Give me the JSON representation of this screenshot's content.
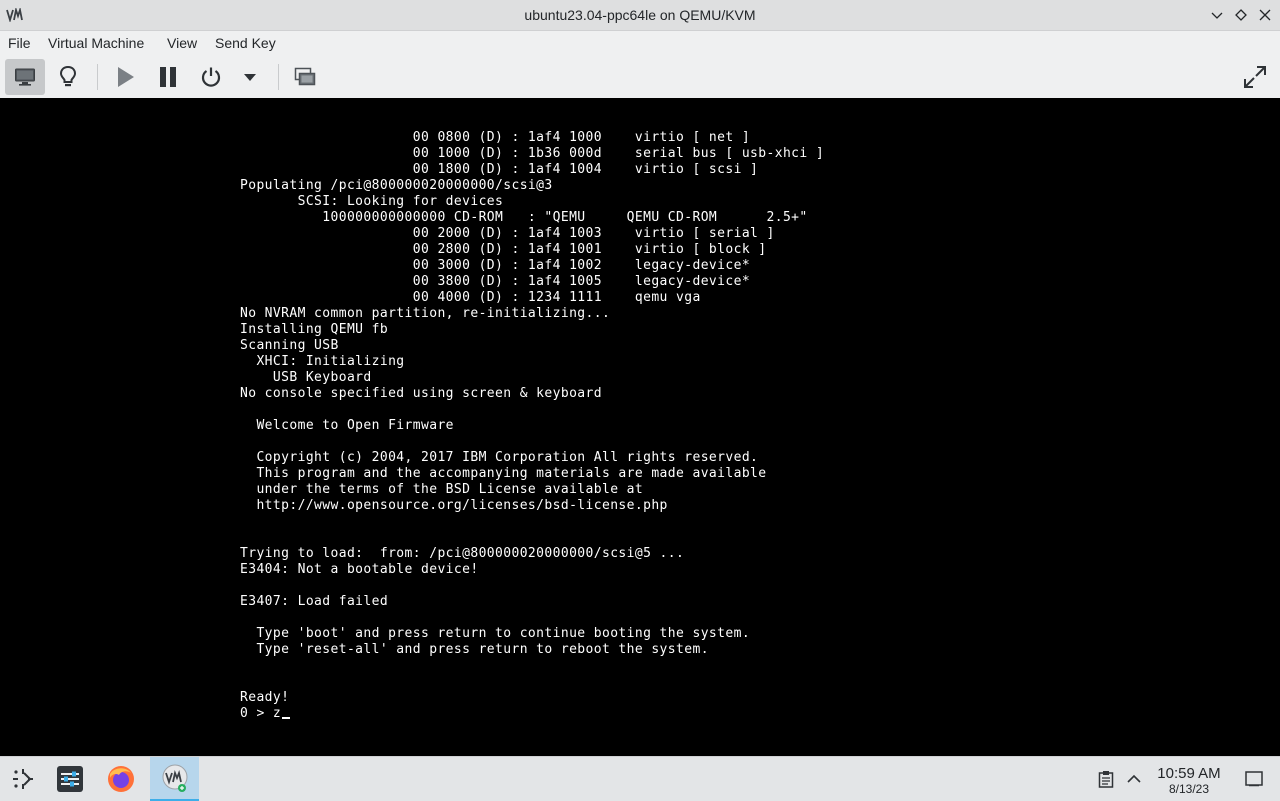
{
  "window": {
    "title": "ubuntu23.04-ppc64le on QEMU/KVM",
    "app_icon": "vm-icon",
    "controls": [
      "minimize-icon",
      "maximize-icon",
      "close-icon"
    ]
  },
  "menubar": {
    "items": [
      {
        "label": "File"
      },
      {
        "label": "Virtual Machine"
      },
      {
        "label": "View"
      },
      {
        "label": "Send Key"
      }
    ]
  },
  "toolbar": {
    "buttons": [
      {
        "icon": "console-monitor-icon",
        "active": true
      },
      {
        "icon": "details-lightbulb-icon",
        "active": false
      },
      {
        "icon": "run-play-icon",
        "active": false
      },
      {
        "icon": "pause-icon",
        "active": false
      },
      {
        "icon": "power-icon",
        "active": false
      },
      {
        "icon": "chevron-down-icon",
        "active": false
      },
      {
        "icon": "snapshots-icon",
        "active": false
      },
      {
        "icon": "fullscreen-icon",
        "active": false
      }
    ]
  },
  "console": {
    "lines": [
      "                     00 0800 (D) : 1af4 1000    virtio [ net ]",
      "                     00 1000 (D) : 1b36 000d    serial bus [ usb-xhci ]",
      "                     00 1800 (D) : 1af4 1004    virtio [ scsi ]",
      "Populating /pci@800000020000000/scsi@3",
      "       SCSI: Looking for devices",
      "          100000000000000 CD-ROM   : \"QEMU     QEMU CD-ROM      2.5+\"",
      "                     00 2000 (D) : 1af4 1003    virtio [ serial ]",
      "                     00 2800 (D) : 1af4 1001    virtio [ block ]",
      "                     00 3000 (D) : 1af4 1002    legacy-device*",
      "                     00 3800 (D) : 1af4 1005    legacy-device*",
      "                     00 4000 (D) : 1234 1111    qemu vga",
      "No NVRAM common partition, re-initializing...",
      "Installing QEMU fb",
      "Scanning USB",
      "  XHCI: Initializing",
      "    USB Keyboard",
      "No console specified using screen & keyboard",
      "",
      "  Welcome to Open Firmware",
      "",
      "  Copyright (c) 2004, 2017 IBM Corporation All rights reserved.",
      "  This program and the accompanying materials are made available",
      "  under the terms of the BSD License available at",
      "  http://www.opensource.org/licenses/bsd-license.php",
      "",
      "",
      "Trying to load:  from: /pci@800000020000000/scsi@5 ...",
      "E3404: Not a bootable device!",
      "",
      "E3407: Load failed",
      "",
      "  Type 'boot' and press return to continue booting the system.",
      "  Type 'reset-all' and press return to reboot the system.",
      "",
      "",
      "Ready!"
    ],
    "prompt": "0 > z"
  },
  "taskbar": {
    "items": [
      {
        "icon": "app-launcher-icon"
      },
      {
        "icon": "system-settings-icon"
      },
      {
        "icon": "firefox-icon"
      },
      {
        "icon": "virt-manager-icon",
        "active": true
      }
    ],
    "tray": {
      "clipboard_icon": "clipboard-icon",
      "expand_icon": "chevron-up-icon",
      "time": "10:59 AM",
      "date": "8/13/23",
      "show_desktop_icon": "show-desktop-icon"
    }
  },
  "colors": {
    "console_bg": "#000000",
    "console_fg": "#ffffff",
    "accent": "#3daee9"
  }
}
